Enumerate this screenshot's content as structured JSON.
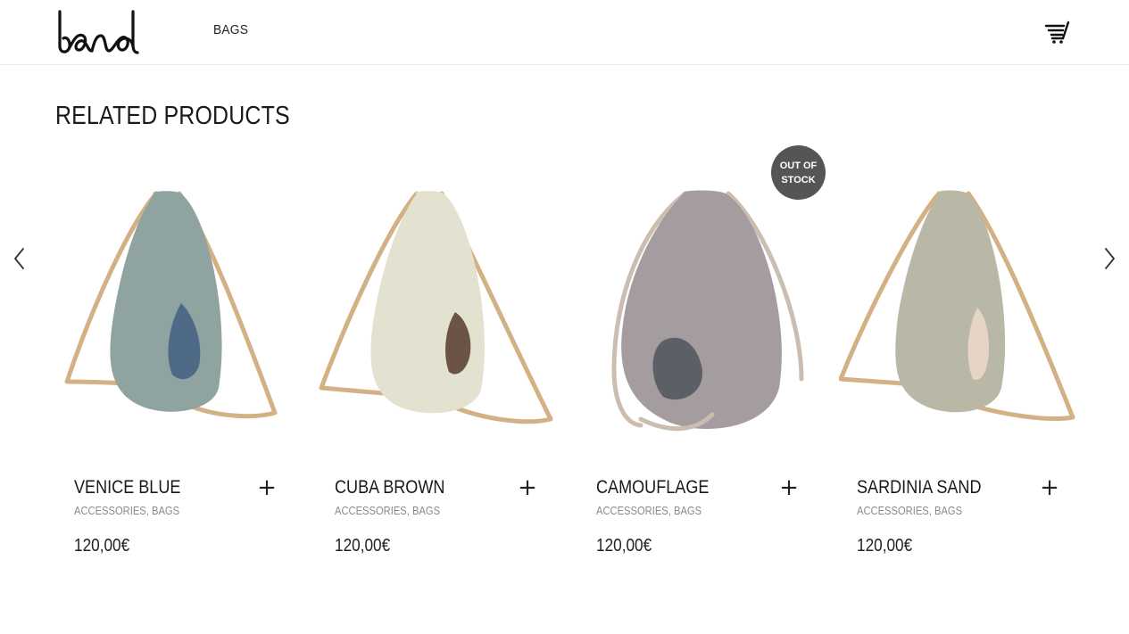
{
  "header": {
    "logo_text": "band",
    "nav": [
      {
        "label": "BAGS"
      }
    ],
    "cart_icon": "cart-icon"
  },
  "section": {
    "title": "RELATED PRODUCTS"
  },
  "carousel": {
    "prev_icon": "chevron-left-icon",
    "next_icon": "chevron-right-icon"
  },
  "products": [
    {
      "name": "VENICE BLUE",
      "category_1": "ACCESSORIES",
      "category_separator": ", ",
      "category_2": "BAGS",
      "price": "120,00€",
      "add_label": "+",
      "colors": {
        "body": "#8fa3a0",
        "inner": "#4e6a86",
        "rope": "#d4b184"
      }
    },
    {
      "name": "CUBA BROWN",
      "category_1": "ACCESSORIES",
      "category_separator": ", ",
      "category_2": "BAGS",
      "price": "120,00€",
      "add_label": "+",
      "colors": {
        "body": "#e3e1cf",
        "inner": "#6b5446",
        "rope": "#d4b184"
      }
    },
    {
      "name": "CAMOUFLAGE",
      "category_1": "ACCESSORIES",
      "category_separator": ", ",
      "category_2": "BAGS",
      "price": "120,00€",
      "add_label": "+",
      "badge_line_1": "OUT OF",
      "badge_line_2": "STOCK",
      "colors": {
        "body": "#a59ca0",
        "inner": "#5c6066",
        "rope": "#cbbdb0"
      }
    },
    {
      "name": "SARDINIA SAND",
      "category_1": "ACCESSORIES",
      "category_separator": ", ",
      "category_2": "BAGS",
      "price": "120,00€",
      "add_label": "+",
      "colors": {
        "body": "#b9b8a6",
        "inner": "#e6d4c5",
        "rope": "#d4b184"
      }
    }
  ]
}
